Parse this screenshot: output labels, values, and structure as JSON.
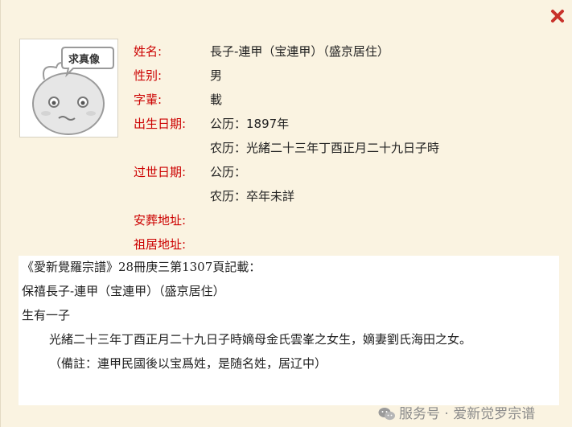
{
  "avatar": {
    "bubble_text": "求真像"
  },
  "profile": {
    "name_label": "姓名:",
    "name_value": "長子-連甲（宝連甲）（盛京居住）",
    "gender_label": "性别:",
    "gender_value": "男",
    "generation_label": "字輩:",
    "generation_value": "載",
    "birth_label": "出生日期:",
    "birth_gregorian": "公历：1897年",
    "birth_lunar": "农历：光緒二十三年丁酉正月二十九日子時",
    "death_label": "过世日期:",
    "death_gregorian": "公历：",
    "death_lunar": "农历：卒年未詳",
    "burial_label": "安葬地址:",
    "ancestral_label": "祖居地址:"
  },
  "record": {
    "line1": "《愛新覺羅宗譜》28冊庚三第1307頁記載：",
    "line2": "保禧長子-連甲（宝連甲）（盛京居住）",
    "line3": "生有一子",
    "line4": "光緒二十三年丁酉正月二十九日子時嫡母金氏雲峯之女生，嫡妻劉氏海田之女。",
    "line5": "（備註：連甲民國後以宝爲姓，是随名姓，居辽中）"
  },
  "watermark": {
    "text": "服务号 · 爱新觉罗宗谱"
  }
}
